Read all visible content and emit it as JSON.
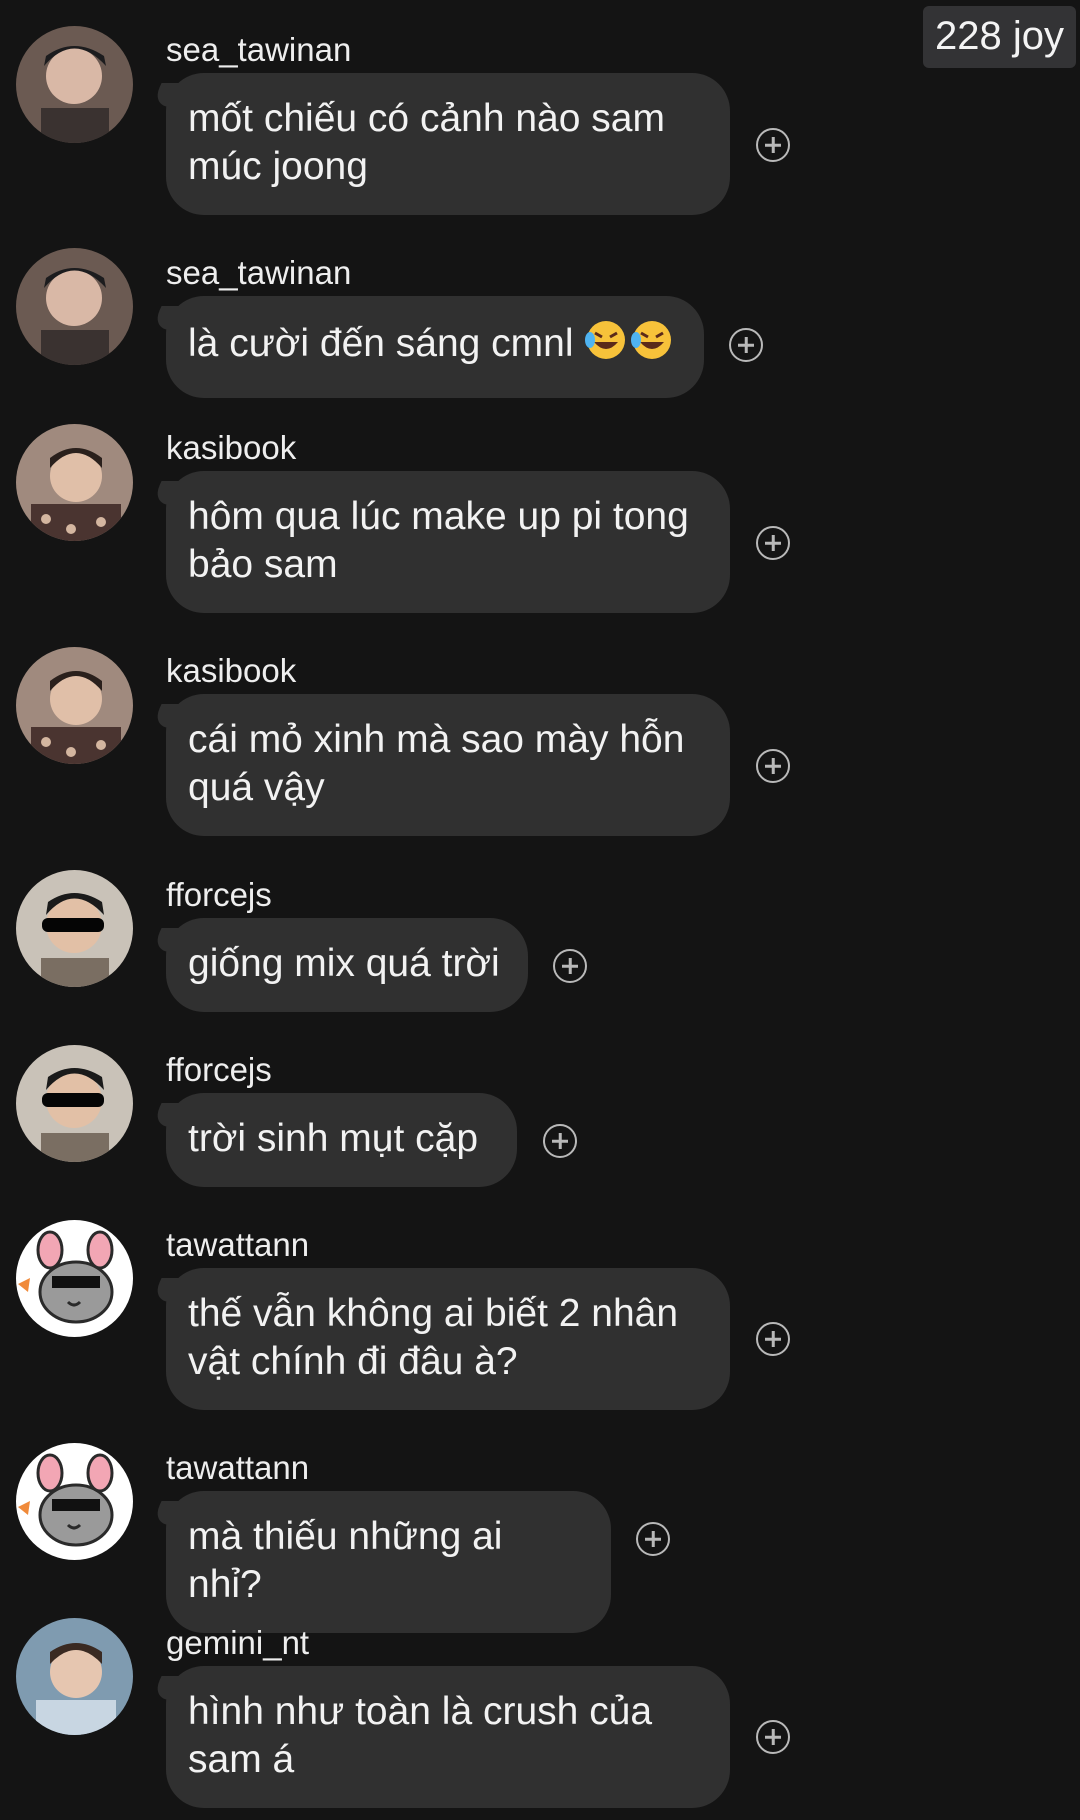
{
  "header": {
    "joy_count": "228 joy"
  },
  "messages": [
    {
      "username": "sea_tawinan",
      "text": "mốt chiếu có cảnh nào sam múc joong",
      "avatar": "portrait-photo"
    },
    {
      "username": "sea_tawinan",
      "text": "là cười đến sáng cmnl",
      "emoji": "face-with-tears-of-joy x2",
      "avatar": "portrait-photo"
    },
    {
      "username": "kasibook",
      "text": "hôm qua lúc make up pi tong bảo sam",
      "avatar": "portrait-photo"
    },
    {
      "username": "kasibook",
      "text": "cái mỏ xinh mà sao mày hỗn quá vậy",
      "avatar": "portrait-photo"
    },
    {
      "username": "fforcejs",
      "text": "giống mix quá trời",
      "avatar": "sunglasses-photo"
    },
    {
      "username": "fforcejs",
      "text": "trời sinh mụt cặp",
      "avatar": "sunglasses-photo"
    },
    {
      "username": "tawattann",
      "text": "thế vẫn không ai biết 2 nhân vật chính đi đâu à?",
      "avatar": "chinchilla-cartoon"
    },
    {
      "username": "tawattann",
      "text": "mà thiếu những ai nhỉ?",
      "avatar": "chinchilla-cartoon"
    },
    {
      "username": "gemini_nt",
      "text": "hình như toàn là crush của sam á",
      "avatar": "portrait-photo"
    }
  ],
  "colors": {
    "background": "#141414",
    "bubble": "#303030",
    "badge": "#333335",
    "icon": "#b9b9b9"
  },
  "icons": {
    "react": "add-reaction-icon"
  }
}
